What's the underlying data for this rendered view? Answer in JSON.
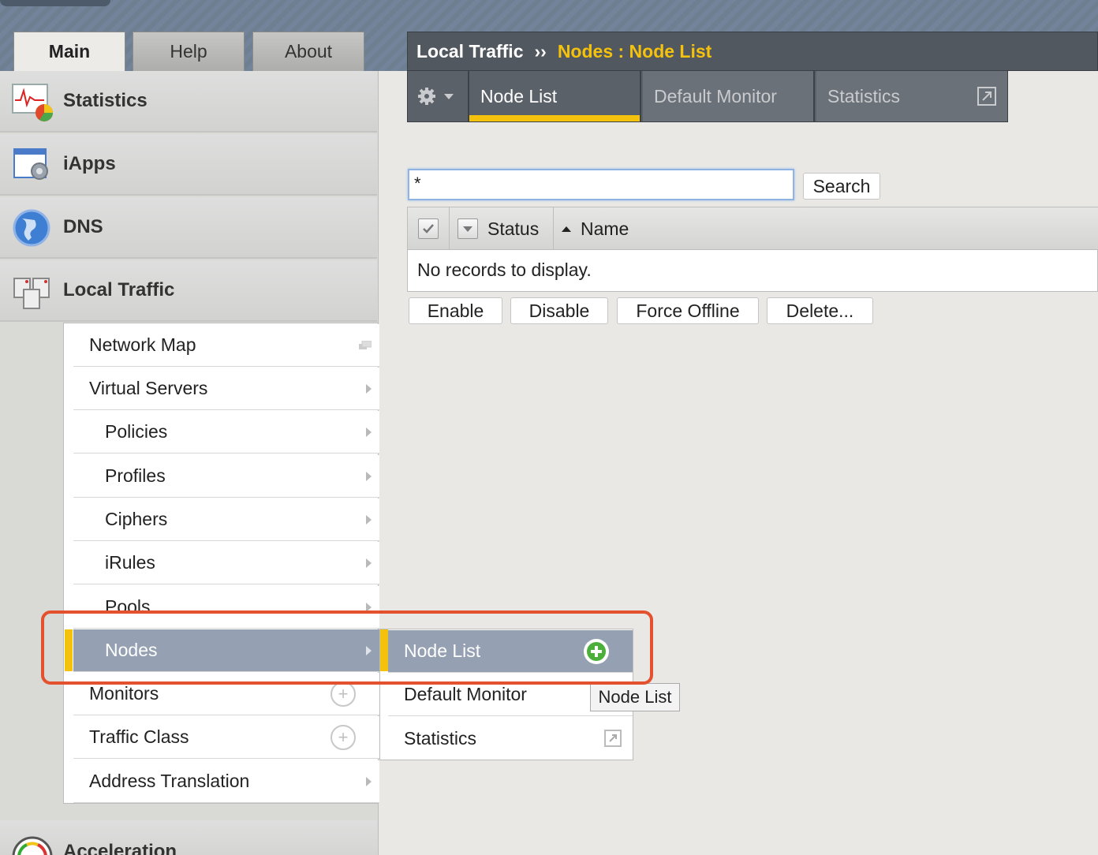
{
  "main_tabs": [
    "Main",
    "Help",
    "About"
  ],
  "left_nav": {
    "sections": [
      "Statistics",
      "iApps",
      "DNS",
      "Local Traffic",
      "Acceleration"
    ],
    "local_traffic_items": [
      "Network Map",
      "Virtual Servers",
      "Policies",
      "Profiles",
      "Ciphers",
      "iRules",
      "Pools",
      "Nodes",
      "Monitors",
      "Traffic Class",
      "Address Translation"
    ],
    "flyout_items": [
      "Node List",
      "Default Monitor",
      "Statistics"
    ]
  },
  "breadcrumb": {
    "section": "Local Traffic",
    "separator": "››",
    "page": "Nodes : Node List"
  },
  "content_tabs": [
    "Node List",
    "Default Monitor",
    "Statistics"
  ],
  "search": {
    "value": "*",
    "button": "Search"
  },
  "grid": {
    "columns": [
      "Status",
      "Name"
    ],
    "empty_message": "No records to display."
  },
  "actions": [
    "Enable",
    "Disable",
    "Force Offline",
    "Delete..."
  ],
  "tooltip": "Node List",
  "colors": {
    "accent": "#f4c20d",
    "highlight": "#e4512e",
    "selected": "#95a1b2"
  },
  "icons": [
    "statistics-icon",
    "iapps-icon",
    "dns-globe-icon",
    "local-traffic-icon",
    "acceleration-icon",
    "gear-icon",
    "chevron-down-icon",
    "popout-icon",
    "add-circle-icon",
    "sort-up-icon",
    "checkbox-icon"
  ]
}
